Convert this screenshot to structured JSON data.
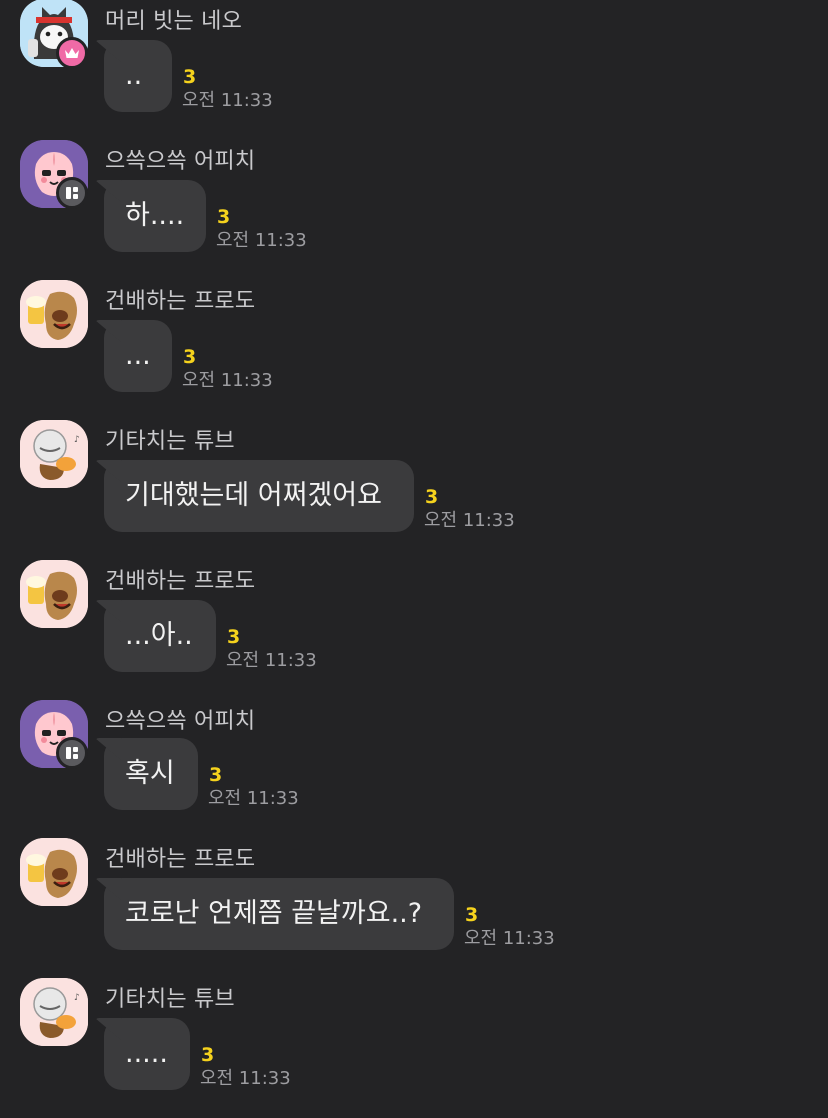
{
  "messages": [
    {
      "name": "머리 빗는 네오",
      "text": "..",
      "unread": "3",
      "time": "오전 11:33",
      "avatar": "neo-avatar",
      "badge": "crown-icon"
    },
    {
      "name": "으쓱으쓱 어피치",
      "text": "하....",
      "unread": "3",
      "time": "오전 11:33",
      "avatar": "apeach-avatar",
      "badge": "grid-icon"
    },
    {
      "name": "건배하는 프로도",
      "text": "...",
      "unread": "3",
      "time": "오전 11:33",
      "avatar": "frodo-avatar",
      "badge": null
    },
    {
      "name": "기타치는 튜브",
      "text": "기대했는데 어쩌겠어요",
      "unread": "3",
      "time": "오전 11:33",
      "avatar": "tube-avatar",
      "badge": null
    },
    {
      "name": "건배하는 프로도",
      "text": "...아..",
      "unread": "3",
      "time": "오전 11:33",
      "avatar": "frodo-avatar",
      "badge": null
    },
    {
      "name": "으쓱으쓱 어피치",
      "text": "혹시",
      "unread": "3",
      "time": "오전 11:33",
      "avatar": "apeach-avatar",
      "badge": "grid-icon"
    },
    {
      "name": "건배하는 프로도",
      "text": "코로난 언제쯤 끝날까요..?",
      "unread": "3",
      "time": "오전 11:33",
      "avatar": "frodo-avatar",
      "badge": null
    },
    {
      "name": "기타치는 튜브",
      "text": ".....",
      "unread": "3",
      "time": "오전 11:33",
      "avatar": "tube-avatar",
      "badge": null
    }
  ],
  "colors": {
    "background": "#232325",
    "bubble": "#3b3b3d",
    "unread": "#f5d21d",
    "name": "#c9c9cc",
    "time": "#9d9da1"
  }
}
